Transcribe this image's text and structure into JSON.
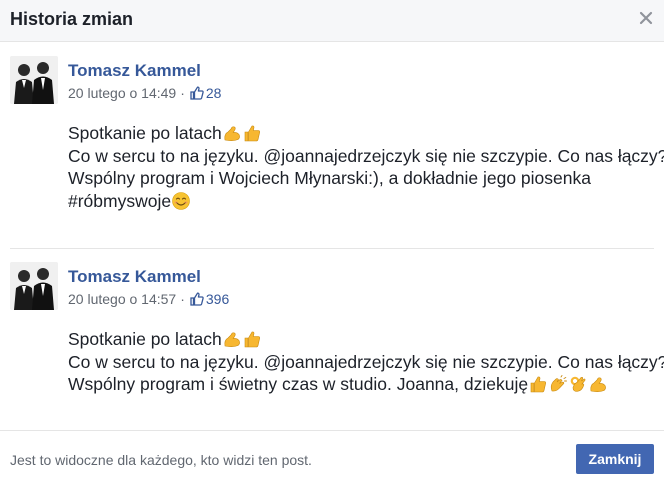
{
  "dialog": {
    "title": "Historia zmian",
    "close_icon": "close-icon"
  },
  "posts": [
    {
      "author": "Tomasz Kammel",
      "timestamp": "20 lutego o 14:49",
      "separator": "·",
      "like_count": "28",
      "lines": [
        "Spotkanie po latach",
        "Co w sercu to na języku. @joannajedrzejczyk się nie szczypie. Co nas łączy?",
        "Wspólny program i Wojciech Młynarski:), a dokładnie jego piosenka",
        "#róbmyswoje"
      ]
    },
    {
      "author": "Tomasz Kammel",
      "timestamp": "20 lutego o 14:57",
      "separator": "·",
      "like_count": "396",
      "lines": [
        "Spotkanie po latach",
        "Co w sercu to na języku. @joannajedrzejczyk się nie szczypie. Co nas łączy?",
        "Wspólny program i świetny czas w studio. Joanna, dziekuję"
      ]
    }
  ],
  "footer": {
    "visibility_text": "Jest to widoczne dla każdego, kto widzi ten post.",
    "close_button_label": "Zamknij"
  },
  "colors": {
    "brand_blue": "#4267b2",
    "link_blue": "#365899",
    "muted_text": "#616770",
    "header_bg": "#f6f7f9"
  },
  "icons": {
    "like": "thumbs-up-icon",
    "emoji_flex": "flexed-biceps-icon",
    "emoji_thumbs": "thumbs-up-emoji-icon",
    "emoji_smile": "smiling-face-icon",
    "emoji_clap": "clapping-hands-icon",
    "emoji_ok": "ok-hand-icon"
  }
}
